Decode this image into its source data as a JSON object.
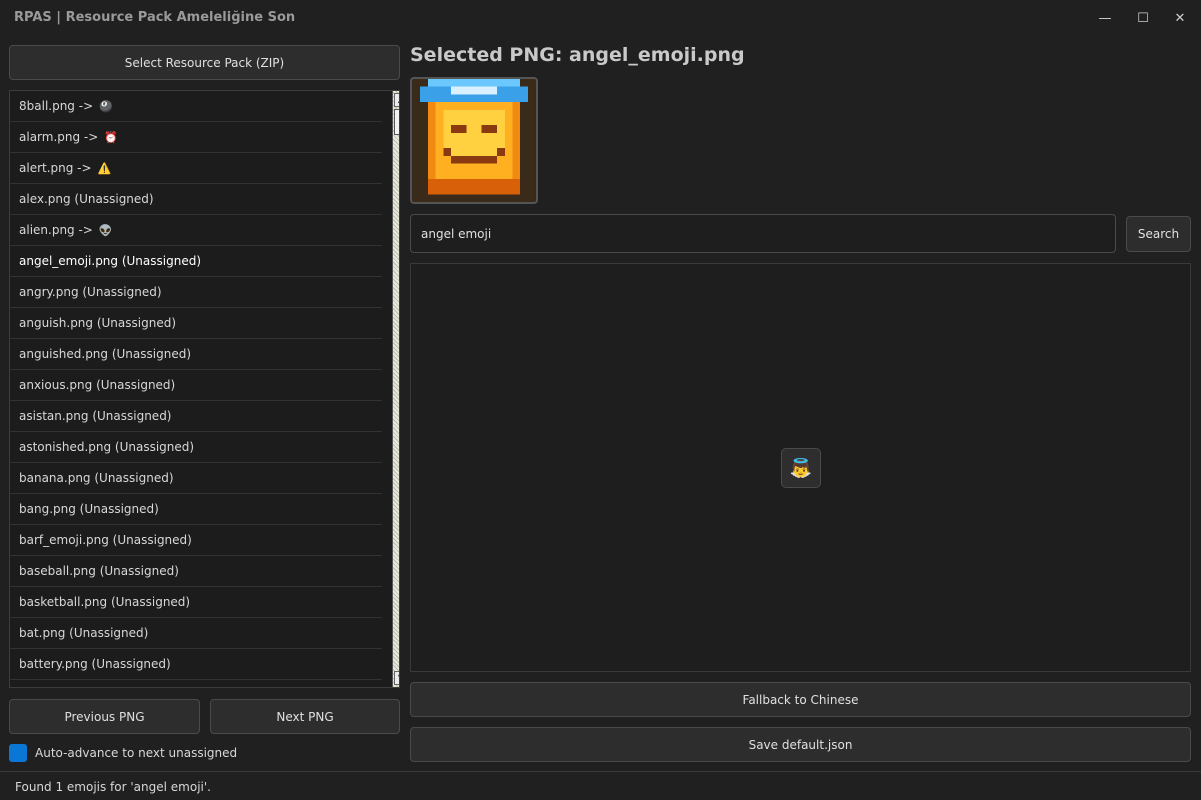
{
  "window": {
    "title": "RPAS | Resource Pack Ameleliğine Son",
    "controls": {
      "minimize": "—",
      "maximize": "☐",
      "close": "✕"
    }
  },
  "left_panel": {
    "select_button": "Select Resource Pack (ZIP)",
    "items": [
      {
        "label": "8ball.png ->",
        "emoji": "🎱"
      },
      {
        "label": "alarm.png ->",
        "emoji": "⏰"
      },
      {
        "label": "alert.png ->",
        "emoji": "⚠️"
      },
      {
        "label": "alex.png (Unassigned)",
        "emoji": ""
      },
      {
        "label": "alien.png ->",
        "emoji": "👽"
      },
      {
        "label": "angel_emoji.png (Unassigned)",
        "emoji": "",
        "selected": true
      },
      {
        "label": "angry.png (Unassigned)",
        "emoji": ""
      },
      {
        "label": "anguish.png (Unassigned)",
        "emoji": ""
      },
      {
        "label": "anguished.png (Unassigned)",
        "emoji": ""
      },
      {
        "label": "anxious.png (Unassigned)",
        "emoji": ""
      },
      {
        "label": "asistan.png (Unassigned)",
        "emoji": ""
      },
      {
        "label": "astonished.png (Unassigned)",
        "emoji": ""
      },
      {
        "label": "banana.png (Unassigned)",
        "emoji": ""
      },
      {
        "label": "bang.png (Unassigned)",
        "emoji": ""
      },
      {
        "label": "barf_emoji.png (Unassigned)",
        "emoji": ""
      },
      {
        "label": "baseball.png (Unassigned)",
        "emoji": ""
      },
      {
        "label": "basketball.png (Unassigned)",
        "emoji": ""
      },
      {
        "label": "bat.png (Unassigned)",
        "emoji": ""
      },
      {
        "label": "battery.png (Unassigned)",
        "emoji": ""
      }
    ],
    "previous_button": "Previous PNG",
    "next_button": "Next PNG",
    "auto_advance_label": "Auto-advance to next unassigned",
    "auto_advance_checked": true
  },
  "right_panel": {
    "heading": "Selected PNG: angel_emoji.png",
    "search_value": "angel emoji",
    "search_button": "Search",
    "results": [
      {
        "emoji": "👼"
      }
    ],
    "fallback_button": "Fallback to Chinese",
    "save_button": "Save default.json"
  },
  "status": {
    "text": "Found 1 emojis for 'angel emoji'."
  },
  "colors": {
    "accent": "#0a76d6",
    "background": "#202020"
  }
}
